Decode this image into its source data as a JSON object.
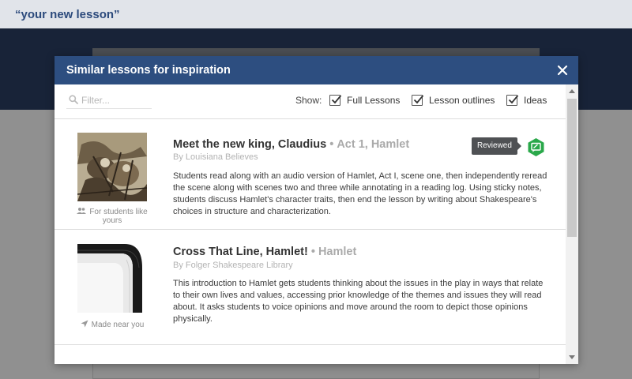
{
  "page": {
    "title": "“your new lesson”"
  },
  "modal": {
    "title": "Similar lessons for inspiration",
    "filter_placeholder": "Filter...",
    "show_label": "Show:",
    "options": [
      {
        "label": "Full Lessons",
        "checked": true
      },
      {
        "label": "Lesson outlines",
        "checked": true
      },
      {
        "label": "Ideas",
        "checked": true
      }
    ]
  },
  "lessons": [
    {
      "title": "Meet the new king, Claudius",
      "separator": "•",
      "subtitle": "Act 1, Hamlet",
      "author": "By Louisiana Believes",
      "description": "Students read along with an audio version of Hamlet, Act I, scene one, then independently reread the scene along with scenes two and three while annotating in a reading log. Using sticky notes, students discuss Hamlet's character traits, then end the lesson by writing about Shakespeare's choices in structure and characterization.",
      "tag": "For students like yours",
      "tag_icon": "people-icon",
      "reviewed_label": "Reviewed",
      "reviewed_color": "#2aa84a"
    },
    {
      "title": "Cross That Line, Hamlet!",
      "separator": "•",
      "subtitle": "Hamlet",
      "author": "By Folger Shakespeare Library",
      "description": "This introduction to Hamlet gets students thinking about the issues in the play in ways that relate to their own lives and values, accessing prior knowledge of the themes and issues they will read about. It asks students to voice opinions and move around the room to depict those opinions physically.",
      "tag": "Made near you",
      "tag_icon": "location-arrow-icon"
    }
  ],
  "colors": {
    "header": "#2d4e80",
    "page_title": "#2c4a7c",
    "dark_band": "#182338"
  }
}
